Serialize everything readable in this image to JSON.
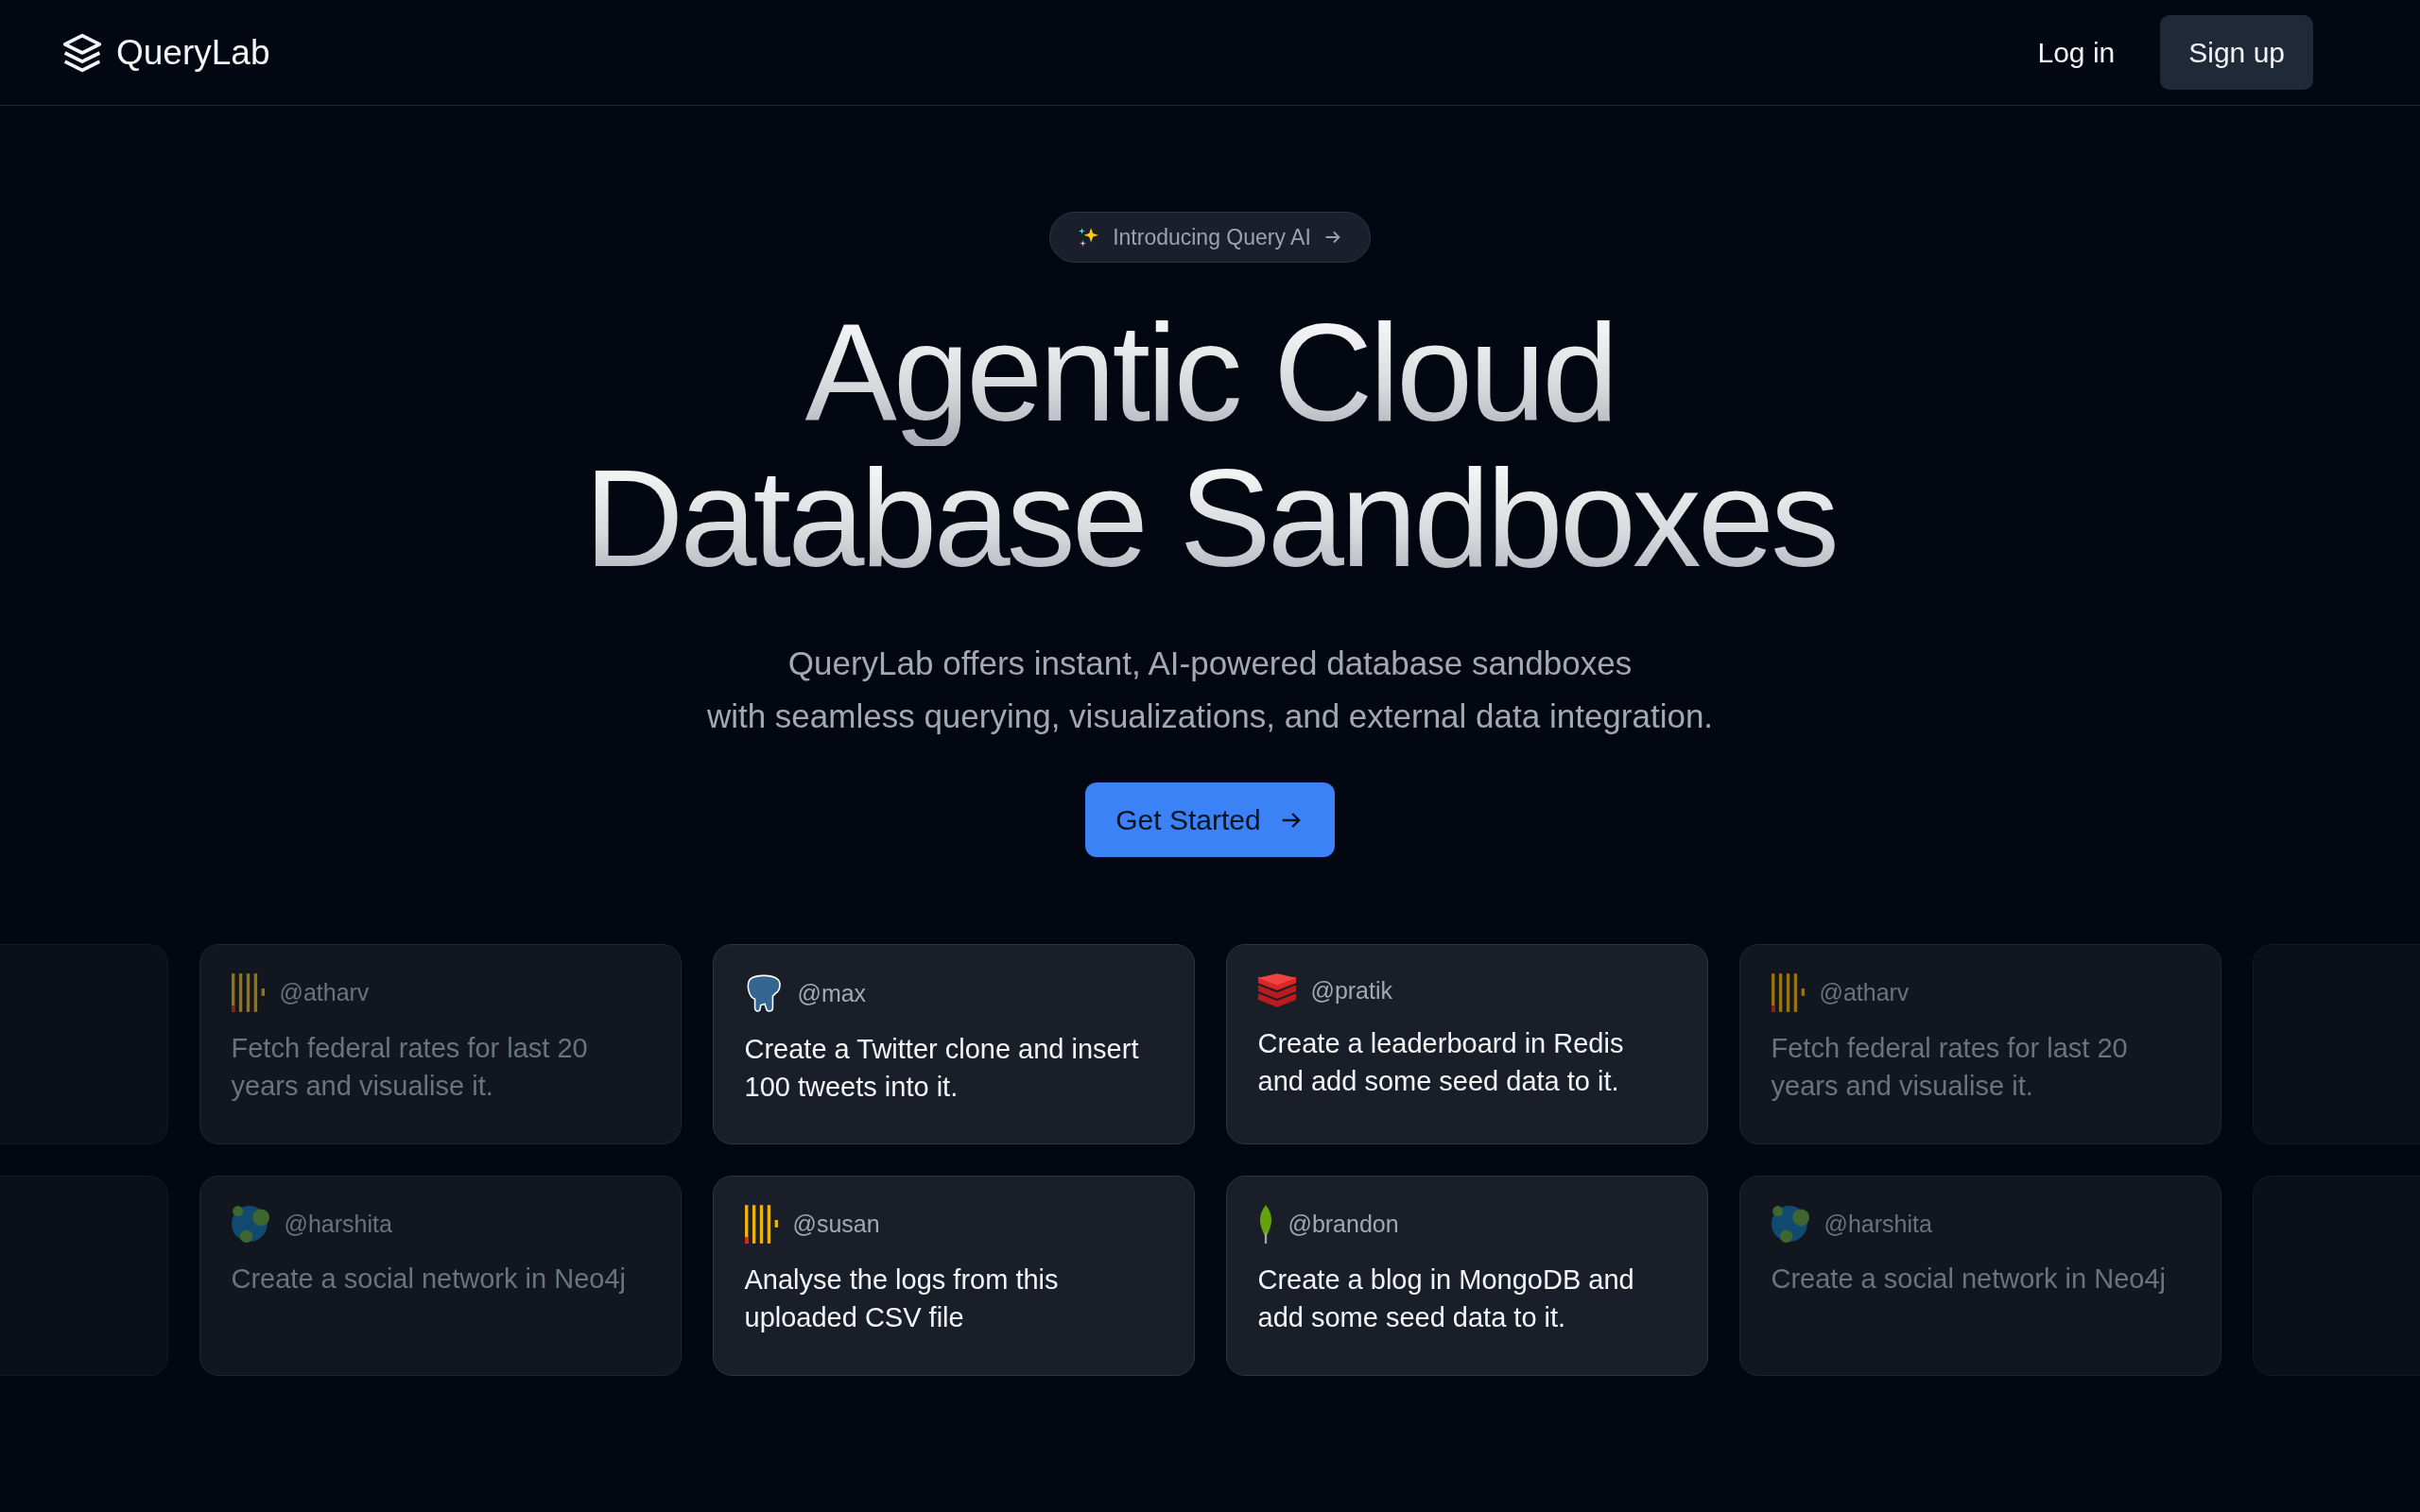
{
  "header": {
    "logo_text": "QueryLab",
    "login": "Log in",
    "signup": "Sign up"
  },
  "hero": {
    "badge": "Introducing Query AI",
    "title_lines": [
      "Agentic Cloud",
      "Database Sandboxes"
    ],
    "subtitle_lines": [
      "QueryLab offers instant, AI-powered database sandboxes",
      "with seamless querying, visualizations, and external data integration."
    ],
    "cta": "Get Started"
  },
  "card_rows": [
    {
      "cards": [
        {
          "kind": "ghost"
        },
        {
          "kind": "bars",
          "handle": "@atharv",
          "text": "Fetch federal rates for last 20 years and visualise it.",
          "dimmed": true
        },
        {
          "kind": "elephant",
          "handle": "@max",
          "text": "Create a Twitter clone and insert 100 tweets into it.",
          "dimmed": false
        },
        {
          "kind": "stack",
          "handle": "@pratik",
          "text": "Create a leaderboard in Redis and add some seed data to it.",
          "dimmed": false
        },
        {
          "kind": "bars",
          "handle": "@atharv",
          "text": "Fetch federal rates for last 20 years and visualise it.",
          "dimmed": true
        },
        {
          "kind": "ghost"
        }
      ]
    },
    {
      "cards": [
        {
          "kind": "ghost"
        },
        {
          "kind": "graph",
          "handle": "@harshita",
          "text": "Create a social network in Neo4j",
          "dimmed": true
        },
        {
          "kind": "bars",
          "handle": "@susan",
          "text": "Analyse the logs from this uploaded CSV file",
          "dimmed": false
        },
        {
          "kind": "leaf",
          "handle": "@brandon",
          "text": "Create a blog in MongoDB and add some seed data to it.",
          "dimmed": false
        },
        {
          "kind": "graph",
          "handle": "@harshita",
          "text": "Create a social network in Neo4j",
          "dimmed": true
        },
        {
          "kind": "ghost"
        }
      ]
    }
  ]
}
